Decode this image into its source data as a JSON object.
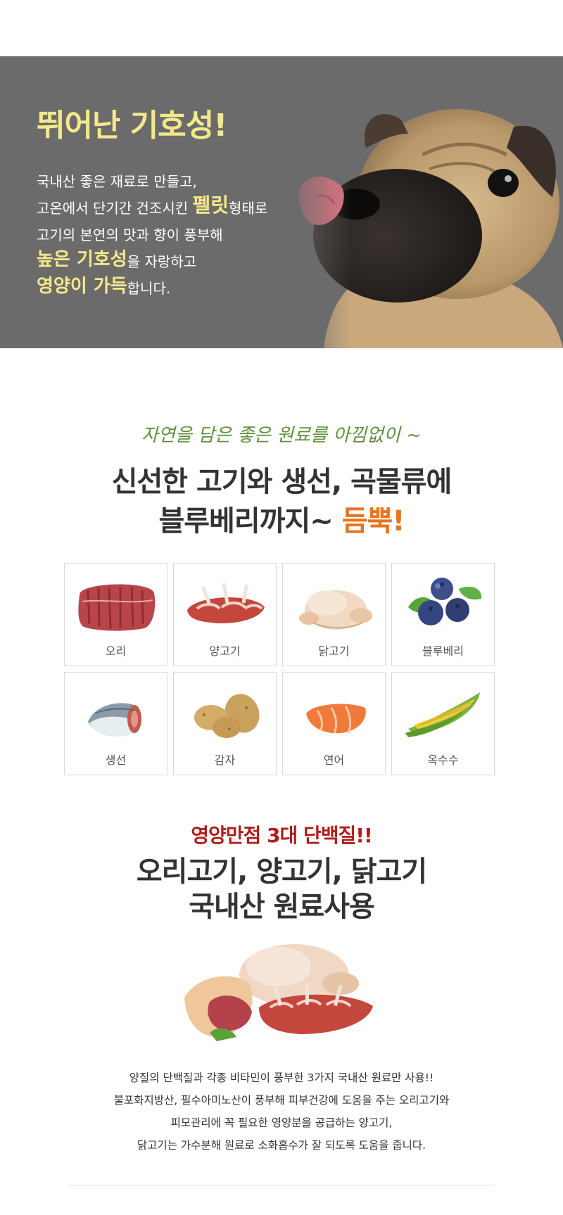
{
  "hero": {
    "title": "뛰어난 기호성!",
    "line1": "국내산 좋은 재료로 만들고,",
    "line2_a": "고온에서 단기간 건조시킨 ",
    "line2_b": "펠릿",
    "line2_c": "형태로",
    "line3": "고기의 본연의 맛과 향이 풍부해",
    "line4_a": "높은 기호성",
    "line4_b": "을 자랑하고",
    "line5_a": "영양이 가득",
    "line5_b": "합니다."
  },
  "ingredients_section": {
    "script_title": "자연을 담은 좋은 원료를 아낌없이 ~",
    "title_line1": "신선한 고기와 생선, 곡물류에",
    "title_line2_a": "블루베리까지~ ",
    "title_line2_b": "듬뿍!",
    "items": [
      {
        "label": "오리",
        "icon": "duck-meat-icon"
      },
      {
        "label": "양고기",
        "icon": "lamb-ribs-icon"
      },
      {
        "label": "닭고기",
        "icon": "chicken-icon"
      },
      {
        "label": "블루베리",
        "icon": "blueberry-icon"
      },
      {
        "label": "생선",
        "icon": "fish-icon"
      },
      {
        "label": "감자",
        "icon": "potato-icon"
      },
      {
        "label": "연어",
        "icon": "salmon-icon"
      },
      {
        "label": "옥수수",
        "icon": "corn-icon"
      }
    ]
  },
  "protein_section": {
    "subtitle": "영양만점 3대 단백질!!",
    "title_line1": "오리고기, 양고기, 닭고기",
    "title_line2": "국내산 원료사용",
    "desc": [
      "양질의 단백질과 각종 비타민이 풍부한 3가지 국내산 원료만 사용!!",
      "불포화지방산, 필수아미노산이 풍부해 피부건강에 도움을 주는 오리고기와",
      "피모관리에 꼭 필요한 영양분을 공급하는 양고기,",
      "닭고기는 가수분해 원료로 소화흡수가 잘 되도록 도움을 줍니다."
    ]
  },
  "colors": {
    "hero_bg": "#6b6b6b",
    "highlight_yellow": "#f4e98a",
    "script_green": "#5f8f3b",
    "accent_orange": "#e8741e",
    "accent_red": "#b11d1d"
  }
}
